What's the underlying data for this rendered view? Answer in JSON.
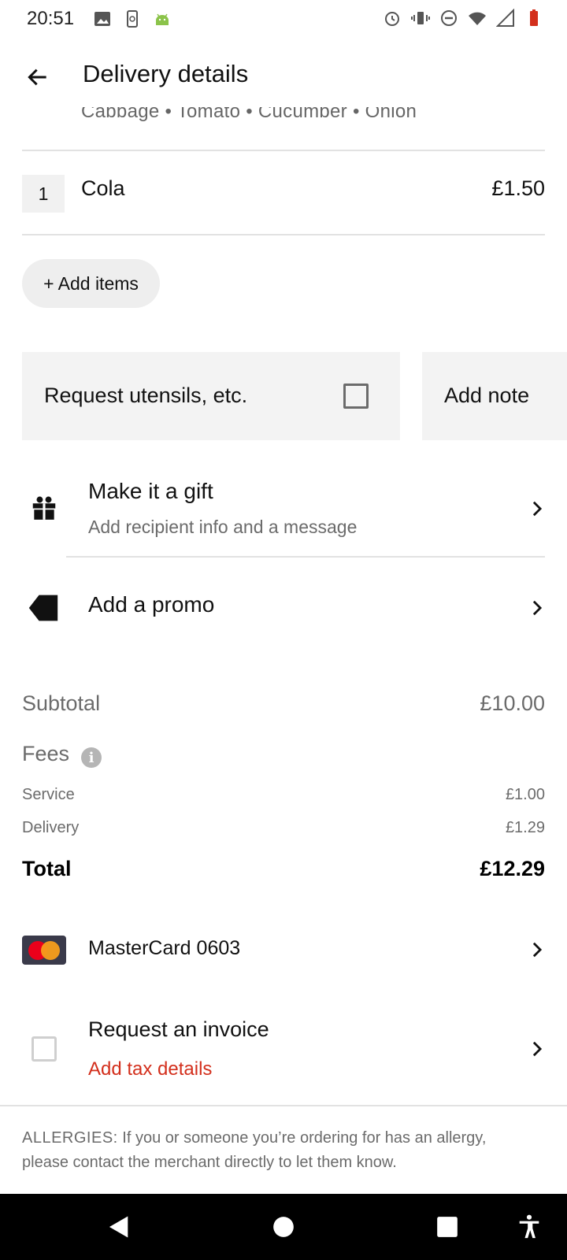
{
  "status_bar": {
    "time": "20:51",
    "left_icons": [
      "image-icon",
      "screen-rotate-icon",
      "android-icon"
    ],
    "right_icons": [
      "alarm-icon",
      "vibrate-icon",
      "do-not-disturb-icon",
      "wifi-icon",
      "signal-icon",
      "battery-icon"
    ]
  },
  "app_bar": {
    "title": "Delivery details",
    "back_icon": "arrow-back-icon"
  },
  "previous_item_options": "Cabbage • Tomato • Cucumber • Onion",
  "cart_items": [
    {
      "quantity": "1",
      "name": "Cola",
      "price": "£1.50"
    }
  ],
  "add_items_label": "+ Add items",
  "utensils": {
    "label": "Request utensils, etc.",
    "checked": false
  },
  "note": {
    "label": "Add note"
  },
  "gift": {
    "title": "Make it a gift",
    "subtitle": "Add recipient info and a message",
    "icon": "gift-icon"
  },
  "promo": {
    "title": "Add a promo",
    "icon": "tag-icon"
  },
  "summary": {
    "subtotal_label": "Subtotal",
    "subtotal_value": "£10.00",
    "fees_label": "Fees",
    "service_label": "Service",
    "service_value": "£1.00",
    "delivery_label": "Delivery",
    "delivery_value": "£1.29",
    "total_label": "Total",
    "total_value": "£12.29"
  },
  "payment": {
    "label": "MasterCard 0603",
    "icon": "mastercard-icon"
  },
  "invoice": {
    "title": "Request an invoice",
    "subtitle": "Add tax details",
    "checked": false
  },
  "allergy": {
    "prefix": "ALLERGIES:",
    "text": " If you or someone you’re ordering for has an allergy, please contact the merchant directly to let them know."
  },
  "colors": {
    "accent_red": "#d32f1c",
    "text_primary": "#111111",
    "text_secondary": "#6b6b6b",
    "card_bg": "#f3f3f3"
  }
}
